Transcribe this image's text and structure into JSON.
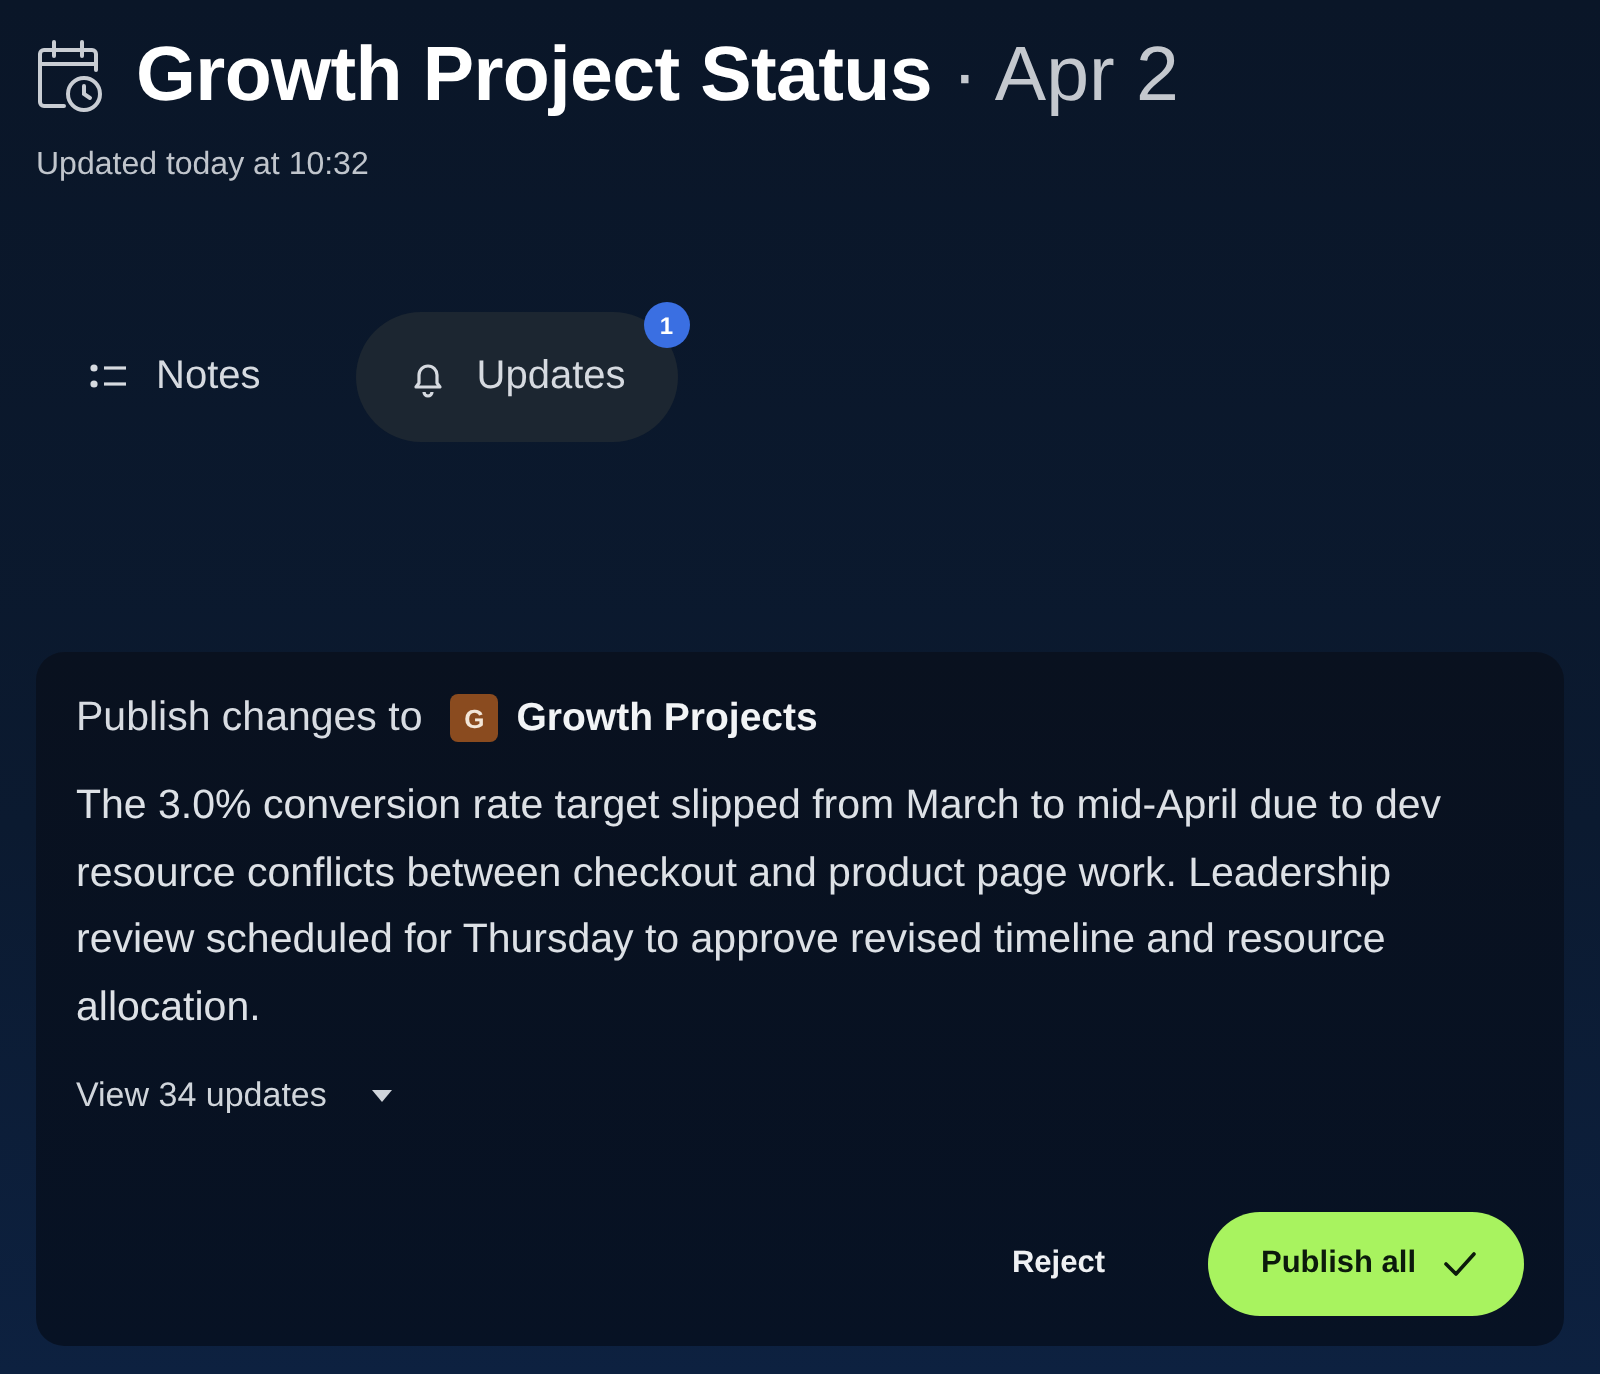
{
  "header": {
    "title": "Growth Project Status",
    "date": "· Apr 2",
    "updated": "Updated today at 10:32"
  },
  "tabs": [
    {
      "label": "Notes",
      "selected": false
    },
    {
      "label": "Updates",
      "selected": true,
      "badge": "1"
    }
  ],
  "publish_card": {
    "prefix": "Publish changes to",
    "project_initial": "G",
    "project_name": "Growth Projects",
    "summary": "The 3.0% conversion rate target slipped from March to mid-April due to dev resource conflicts between checkout and product page work. Leadership review scheduled for Thursday to approve revised timeline and resource allocation.",
    "view_updates": {
      "label": "View 34 updates",
      "expanded": false
    },
    "actions": [
      {
        "label": "Reject",
        "kind": "secondary"
      },
      {
        "label": "Publish all",
        "kind": "primary"
      }
    ]
  }
}
